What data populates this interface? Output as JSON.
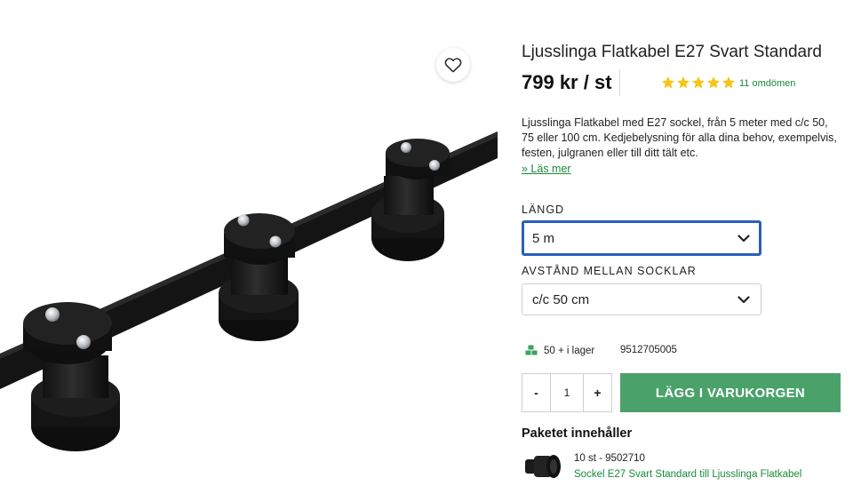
{
  "product": {
    "title": "Ljusslinga Flatkabel E27 Svart Standard",
    "price": "799 kr / st",
    "rating": 5,
    "reviews_label": "11 omdömen",
    "description": "Ljusslinga Flatkabel med E27 sockel, från 5 meter med c/c 50, 75 eller 100 cm. Kedjebelysning för alla dina behov, exempelvis, festen, julgranen eller till ditt tält etc.",
    "read_more": "» Läs mer"
  },
  "options": {
    "length_label": "LÄNGD",
    "length_value": "5 m",
    "spacing_label": "AVSTÅND MELLAN SOCKLAR",
    "spacing_value": "c/c 50 cm"
  },
  "stock": {
    "text": "50 + i lager",
    "sku": "9512705005"
  },
  "cart": {
    "minus": "-",
    "quantity": "1",
    "plus": "+",
    "add_label": "LÄGG I VARUKORGEN"
  },
  "package": {
    "title": "Paketet innehåller",
    "item_qty": "10 st - 9502710",
    "item_name": "Sockel E27 Svart Standard till Ljusslinga Flatkabel"
  },
  "icons": {
    "favorite": "heart-icon",
    "star": "star-icon",
    "chevron": "chevron-down-icon",
    "stock": "stock-icon"
  },
  "colors": {
    "accent_green": "#4aa26a",
    "link_green": "#1a8a3d",
    "star_yellow": "#f5c518",
    "focus_blue": "#2b5fbe"
  }
}
